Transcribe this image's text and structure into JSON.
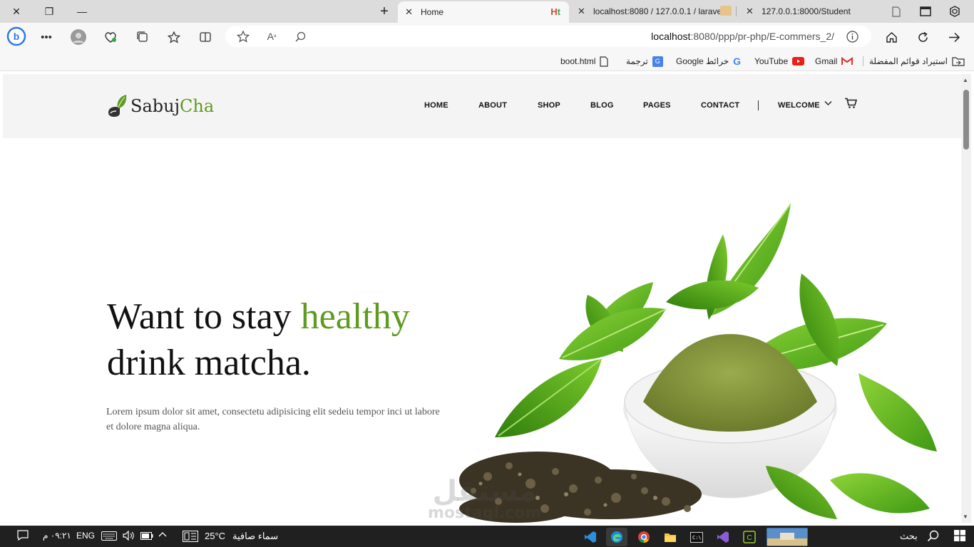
{
  "browser": {
    "window_controls": {
      "close_icon": "✕",
      "restore_icon": "❐",
      "minimize_icon": "—"
    },
    "new_tab_icon": "+",
    "tabs": [
      {
        "label": "Home",
        "active": true
      },
      {
        "label": "localhost:8080 / 127.0.0.1 / larave",
        "active": false
      },
      {
        "label": "127.0.0.1:8000/Student",
        "active": false
      }
    ],
    "address": {
      "host": "localhost",
      "path": ":8080/ppp/pr-php/E-commers_2/"
    }
  },
  "bookmarks": [
    {
      "label": "boot.html",
      "icon": "file-icon"
    },
    {
      "label": "ترجمة",
      "icon": "translate-icon"
    },
    {
      "label": "Google خرائط",
      "icon": "google-icon"
    },
    {
      "label": "YouTube",
      "icon": "youtube-icon"
    },
    {
      "label": "Gmail",
      "icon": "gmail-icon"
    },
    {
      "label": "استيراد قوائم المفضلة",
      "icon": "folder-import-icon"
    }
  ],
  "site": {
    "logo": {
      "part1": "Sabuj",
      "part2": "Cha"
    },
    "nav": [
      "HOME",
      "ABOUT",
      "SHOP",
      "BLOG",
      "PAGES",
      "CONTACT",
      "WELCOME"
    ],
    "hero": {
      "title_part1": "Want to stay ",
      "title_highlight": "healthy",
      "title_line2": "drink matcha.",
      "text": "Lorem ipsum dolor sit amet, consectetu adipisicing elit sedeiu tempor inci ut labore et dolore magna aliqua."
    }
  },
  "taskbar": {
    "time": "٠٩:٢١ م",
    "lang": "ENG",
    "weather_temp": "25°C",
    "weather_text": "سماء صافية",
    "search_label": "بحث"
  },
  "watermark": {
    "line1": "مستقل",
    "line2": "mostaql.com"
  },
  "colors": {
    "accent": "#5e9b1e",
    "header_bg": "#f4f4f4",
    "taskbar_bg": "#202020"
  }
}
